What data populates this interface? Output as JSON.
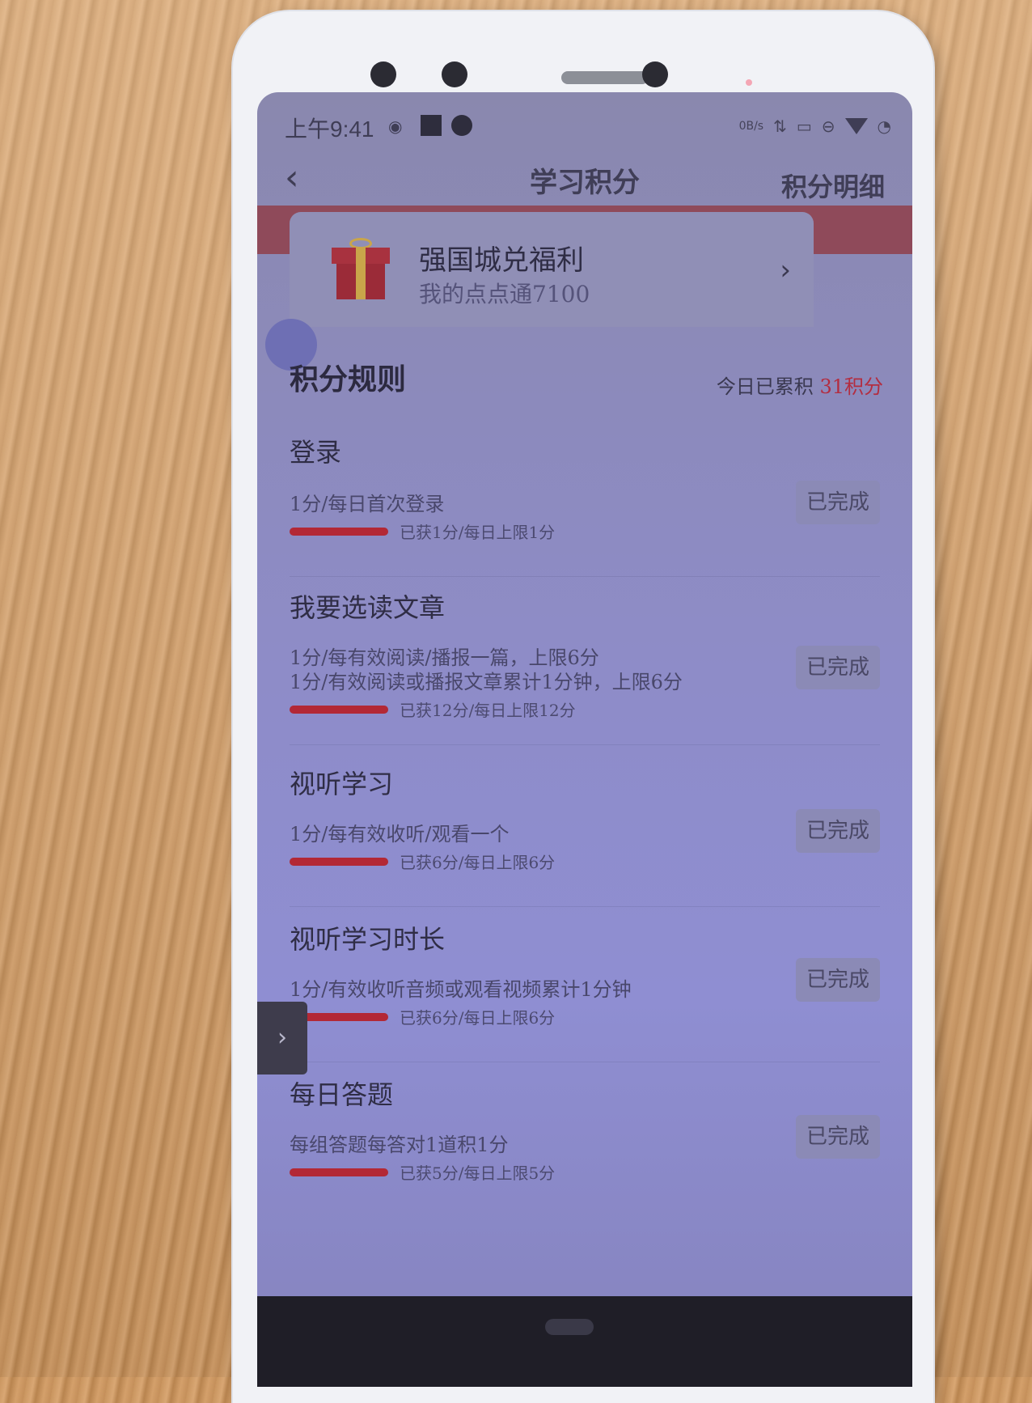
{
  "status_bar": {
    "time": "上午9:41",
    "network_speed": "0B/s",
    "icons": [
      "media-icon",
      "square-icon",
      "circle-icon",
      "data-arrows-icon",
      "cast-icon",
      "dnd-icon",
      "wifi-icon",
      "battery-icon"
    ]
  },
  "nav": {
    "back_icon": "chevron-left-icon",
    "title": "学习积分",
    "right_label": "积分明细"
  },
  "mall": {
    "title": "强国城兑福利",
    "subtitle": "我的点点通7100",
    "icon": "gift-icon"
  },
  "rules": {
    "title": "积分规则",
    "today_label": "今日已累积",
    "today_value": "31积分"
  },
  "tasks": [
    {
      "title": "登录",
      "desc": [
        "1分/每日首次登录"
      ],
      "progress_text": "已获1分/每日上限1分",
      "progress": 1.0,
      "button": "已完成"
    },
    {
      "title": "我要选读文章",
      "desc": [
        "1分/每有效阅读/播报一篇，上限6分",
        "1分/有效阅读或播报文章累计1分钟，上限6分"
      ],
      "progress_text": "已获12分/每日上限12分",
      "progress": 1.0,
      "button": "已完成"
    },
    {
      "title": "视听学习",
      "desc": [
        "1分/每有效收听/观看一个"
      ],
      "progress_text": "已获6分/每日上限6分",
      "progress": 1.0,
      "button": "已完成"
    },
    {
      "title": "视听学习时长",
      "desc": [
        "1分/有效收听音频或观看视频累计1分钟"
      ],
      "progress_text": "已获6分/每日上限6分",
      "progress": 1.0,
      "button": "已完成"
    },
    {
      "title": "每日答题",
      "desc": [
        "每组答题每答对1道积1分"
      ],
      "progress_text": "已获5分/每日上限5分",
      "progress": 1.0,
      "button": "已完成"
    }
  ],
  "side_tab_icon": "chevron-right-icon",
  "colors": {
    "accent_red": "#b32835",
    "screen_tint": "#8e8cc8"
  }
}
